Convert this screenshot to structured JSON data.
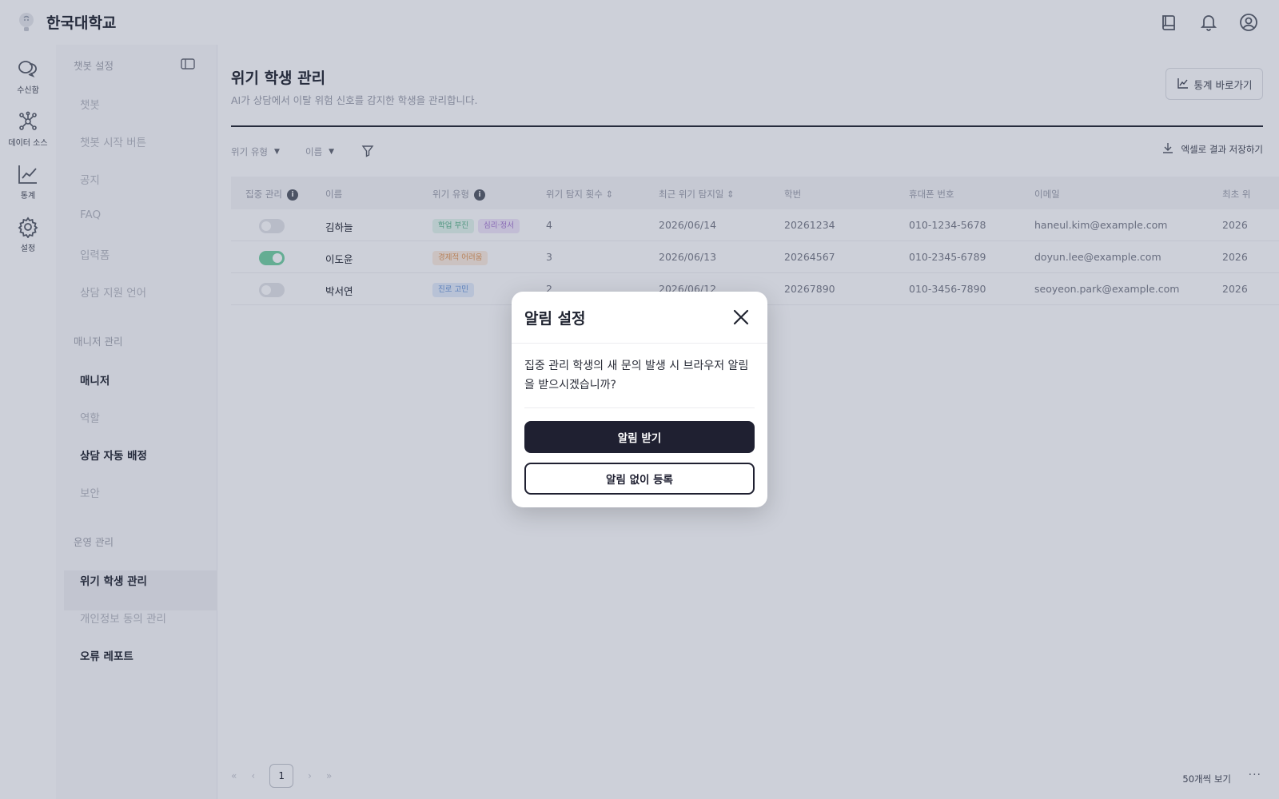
{
  "app": {
    "brand": "한국대학교"
  },
  "topbar": {
    "icons": [
      "book-icon",
      "bell-icon",
      "user-circle-icon"
    ]
  },
  "rail": {
    "items": [
      {
        "label": "수신함",
        "icon": "chat-bubbles-icon"
      },
      {
        "label": "데이터 소스",
        "icon": "network-icon"
      },
      {
        "label": "통계",
        "icon": "chart-line-icon"
      },
      {
        "label": "설정",
        "icon": "gear-icon"
      }
    ]
  },
  "sidebar": {
    "section1": {
      "title": "챗봇 설정",
      "items": [
        "챗봇",
        "챗봇 시작 버튼",
        "공지",
        "FAQ",
        "입력폼",
        "상담 지원 언어"
      ]
    },
    "section2": {
      "title": "매니저 관리",
      "items": [
        "매니저",
        "역할",
        "상담 자동 배정",
        "보안"
      ]
    },
    "section3": {
      "title": "운영 관리",
      "items": [
        "위기 학생 관리",
        "개인정보 동의 관리",
        "오류 레포트"
      ]
    }
  },
  "page": {
    "title": "위기 학생 관리",
    "subtitle": "AI가 상담에서 이탈 위험 신호를 감지한 학생을 관리합니다.",
    "stats_button": "통계 바로가기",
    "filters": [
      "위기 유형",
      "이름"
    ],
    "excel_button": "엑셀로 결과 저장하기"
  },
  "table": {
    "headers": [
      "집중 관리",
      "이름",
      "위기 유형",
      "위기 탐지 횟수 ⇕",
      "최근 위기 탐지일 ⇕",
      "학번",
      "휴대폰 번호",
      "이메일",
      "최초 위"
    ],
    "rows": [
      {
        "focus": false,
        "name": "김하늘",
        "tags": [
          {
            "text": "학업 부진",
            "color": "green"
          },
          {
            "text": "심리·정서",
            "color": "purple"
          }
        ],
        "count": "4",
        "date": "2026/06/14",
        "student_id": "20261234",
        "phone": "010-1234-5678",
        "email": "haneul.kim@example.com",
        "first": "2026"
      },
      {
        "focus": true,
        "name": "이도윤",
        "tags": [
          {
            "text": "경제적 어려움",
            "color": "orange"
          }
        ],
        "count": "3",
        "date": "2026/06/13",
        "student_id": "20264567",
        "phone": "010-2345-6789",
        "email": "doyun.lee@example.com",
        "first": "2026"
      },
      {
        "focus": false,
        "name": "박서연",
        "tags": [
          {
            "text": "진로 고민",
            "color": "blue"
          }
        ],
        "count": "2",
        "date": "2026/06/12",
        "student_id": "20267890",
        "phone": "010-3456-7890",
        "email": "seoyeon.park@example.com",
        "first": "2026"
      }
    ]
  },
  "pagination": {
    "current": "1",
    "page_size": "50개씩 보기",
    "more": "···"
  },
  "dialog": {
    "title": "알림 설정",
    "body": "집중 관리 학생의 새 문의 발생 시 브라우저 알림을 받으시겠습니까?",
    "primary": "알림 받기",
    "secondary": "알림 없이 등록"
  },
  "colors": {
    "accent": "#1f2031",
    "overlay": "#1c2854",
    "toggle_on": "#79d3a6"
  }
}
